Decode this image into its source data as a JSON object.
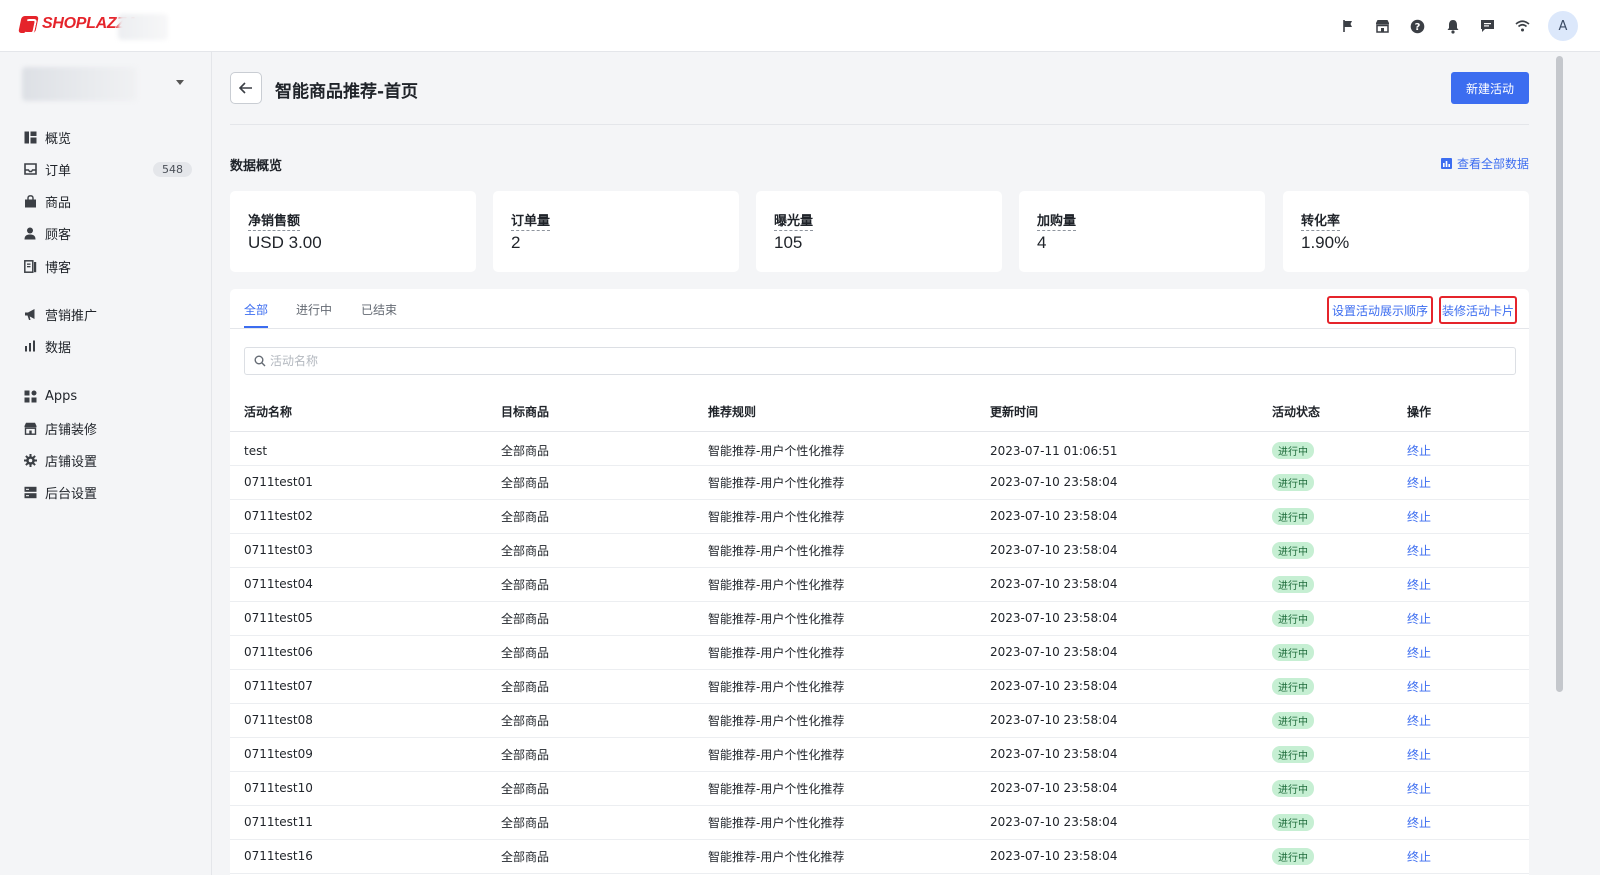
{
  "topbar": {
    "brand": "SHOPLAZZA",
    "icons": [
      "flag-icon",
      "store-icon",
      "help-icon",
      "bell-icon",
      "chat-icon",
      "wifi-icon"
    ],
    "avatar_initial": "A"
  },
  "sidebar": {
    "items": [
      {
        "label": "概览",
        "icon": "overview-icon"
      },
      {
        "label": "订单",
        "icon": "inbox-icon",
        "badge": "548"
      },
      {
        "label": "商品",
        "icon": "bag-icon"
      },
      {
        "label": "顾客",
        "icon": "user-icon"
      },
      {
        "label": "博客",
        "icon": "blog-icon"
      },
      {
        "label": "营销推广",
        "icon": "megaphone-icon"
      },
      {
        "label": "数据",
        "icon": "bar-chart-icon"
      },
      {
        "label": "Apps",
        "icon": "apps-icon"
      },
      {
        "label": "店铺装修",
        "icon": "storefront-icon"
      },
      {
        "label": "店铺设置",
        "icon": "gear-icon"
      },
      {
        "label": "后台设置",
        "icon": "server-icon"
      }
    ]
  },
  "header": {
    "title": "智能商品推荐-首页",
    "new_button": "新建活动"
  },
  "overview": {
    "title": "数据概览",
    "view_all": "查看全部数据",
    "stats": [
      {
        "label": "净销售额",
        "value": "USD 3.00"
      },
      {
        "label": "订单量",
        "value": "2"
      },
      {
        "label": "曝光量",
        "value": "105"
      },
      {
        "label": "加购量",
        "value": "4"
      },
      {
        "label": "转化率",
        "value": "1.90%"
      }
    ]
  },
  "tabs": [
    {
      "label": "全部",
      "active": true
    },
    {
      "label": "进行中",
      "active": false
    },
    {
      "label": "已结束",
      "active": false
    }
  ],
  "links": {
    "set_order": "设置活动展示顺序",
    "decorate_card": "装修活动卡片"
  },
  "search": {
    "placeholder": "活动名称",
    "value": ""
  },
  "table": {
    "columns": [
      "活动名称",
      "目标商品",
      "推荐规则",
      "更新时间",
      "活动状态",
      "操作"
    ],
    "rows": [
      [
        "test",
        "全部商品",
        "智能推荐-用户个性化推荐",
        "2023-07-11 01:06:51",
        "进行中",
        "终止"
      ],
      [
        "0711test01",
        "全部商品",
        "智能推荐-用户个性化推荐",
        "2023-07-10 23:58:04",
        "进行中",
        "终止"
      ],
      [
        "0711test02",
        "全部商品",
        "智能推荐-用户个性化推荐",
        "2023-07-10 23:58:04",
        "进行中",
        "终止"
      ],
      [
        "0711test03",
        "全部商品",
        "智能推荐-用户个性化推荐",
        "2023-07-10 23:58:04",
        "进行中",
        "终止"
      ],
      [
        "0711test04",
        "全部商品",
        "智能推荐-用户个性化推荐",
        "2023-07-10 23:58:04",
        "进行中",
        "终止"
      ],
      [
        "0711test05",
        "全部商品",
        "智能推荐-用户个性化推荐",
        "2023-07-10 23:58:04",
        "进行中",
        "终止"
      ],
      [
        "0711test06",
        "全部商品",
        "智能推荐-用户个性化推荐",
        "2023-07-10 23:58:04",
        "进行中",
        "终止"
      ],
      [
        "0711test07",
        "全部商品",
        "智能推荐-用户个性化推荐",
        "2023-07-10 23:58:04",
        "进行中",
        "终止"
      ],
      [
        "0711test08",
        "全部商品",
        "智能推荐-用户个性化推荐",
        "2023-07-10 23:58:04",
        "进行中",
        "终止"
      ],
      [
        "0711test09",
        "全部商品",
        "智能推荐-用户个性化推荐",
        "2023-07-10 23:58:04",
        "进行中",
        "终止"
      ],
      [
        "0711test10",
        "全部商品",
        "智能推荐-用户个性化推荐",
        "2023-07-10 23:58:04",
        "进行中",
        "终止"
      ],
      [
        "0711test11",
        "全部商品",
        "智能推荐-用户个性化推荐",
        "2023-07-10 23:58:04",
        "进行中",
        "终止"
      ],
      [
        "0711test16",
        "全部商品",
        "智能推荐-用户个性化推荐",
        "2023-07-10 23:58:04",
        "进行中",
        "终止"
      ]
    ]
  },
  "colors": {
    "accent": "#3c6df0",
    "brand": "#e5242b",
    "highlight_border": "#e5242b",
    "status_bg": "#c6efd3",
    "status_text": "#1d6b3a"
  }
}
